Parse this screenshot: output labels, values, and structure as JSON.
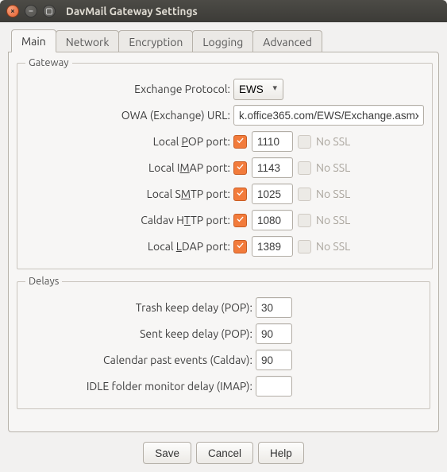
{
  "window": {
    "title": "DavMail Gateway Settings"
  },
  "tabs": {
    "main": "Main",
    "network": "Network",
    "encryption": "Encryption",
    "logging": "Logging",
    "advanced": "Advanced"
  },
  "groups": {
    "gateway": "Gateway",
    "delays": "Delays"
  },
  "gateway": {
    "exchange_protocol_label": "Exchange Protocol:",
    "exchange_protocol_value": "EWS",
    "owa_url_label": "OWA (Exchange) URL:",
    "owa_url_value": "k.office365.com/EWS/Exchange.asmx",
    "pop_label_pre": "Local ",
    "pop_label_m": "P",
    "pop_label_post": "OP port:",
    "pop_value": "1110",
    "imap_label_pre": "Local I",
    "imap_label_m": "M",
    "imap_label_post": "AP port:",
    "imap_value": "1143",
    "smtp_label_pre": "Local S",
    "smtp_label_m": "M",
    "smtp_label_post": "TP port:",
    "smtp_value": "1025",
    "caldav_label_pre": "Caldav H",
    "caldav_label_m": "T",
    "caldav_label_post": "TP port:",
    "caldav_value": "1080",
    "ldap_label_pre": "Local ",
    "ldap_label_m": "L",
    "ldap_label_post": "DAP port:",
    "ldap_value": "1389",
    "nossl_label": "No SSL"
  },
  "delays": {
    "trash_label": "Trash keep delay (POP):",
    "trash_value": "30",
    "sent_label": "Sent keep delay (POP):",
    "sent_value": "90",
    "calendar_label": "Calendar past events (Caldav):",
    "calendar_value": "90",
    "idle_label": "IDLE folder monitor delay (IMAP):",
    "idle_value": ""
  },
  "buttons": {
    "save": "Save",
    "cancel": "Cancel",
    "help": "Help"
  }
}
